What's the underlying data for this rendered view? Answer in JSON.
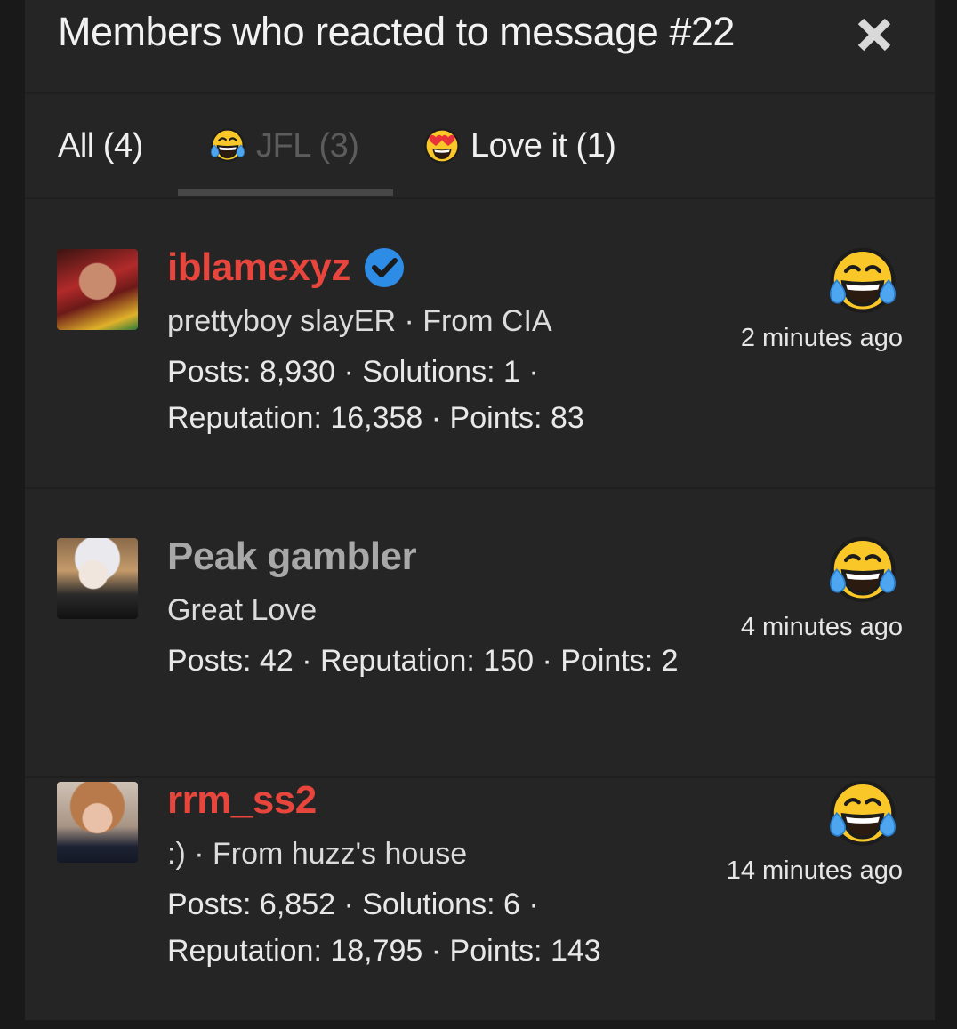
{
  "dialog": {
    "title": "Members who reacted to message #22",
    "close_icon": "close-icon"
  },
  "tabs": [
    {
      "label": "All (4)",
      "icon": null,
      "selected": false
    },
    {
      "label": "JFL (3)",
      "icon": "laughing-crying-emoji-icon",
      "selected": true
    },
    {
      "label": "Love it (1)",
      "icon": "heart-eyes-emoji-icon",
      "selected": false
    }
  ],
  "colors": {
    "name_red": "#e8453c",
    "name_gray": "#a8a8a8",
    "verified_blue": "#2d8ce6",
    "panel_bg": "#252525"
  },
  "members": [
    {
      "name": "iblamexyz",
      "verified": true,
      "name_color": "#e8453c",
      "subtitle": "prettyboy slayER · From CIA",
      "stats": "Posts: 8,930 · Solutions: 1 · Reputation: 16,358 · Points: 83",
      "reaction_icon": "laughing-crying-emoji-icon",
      "time": "2 minutes ago"
    },
    {
      "name": "Peak gambler",
      "verified": false,
      "name_color": "#a8a8a8",
      "subtitle": "Great Love",
      "stats": "Posts: 42 · Reputation: 150 · Points: 2",
      "reaction_icon": "laughing-crying-emoji-icon",
      "time": "4 minutes ago"
    },
    {
      "name": "rrm_ss2",
      "verified": false,
      "name_color": "#e8453c",
      "subtitle": ":) · From huzz's house",
      "stats": "Posts: 6,852 · Solutions: 6 · Reputation: 18,795 · Points: 143",
      "reaction_icon": "laughing-crying-emoji-icon",
      "time": "14 minutes ago"
    }
  ]
}
